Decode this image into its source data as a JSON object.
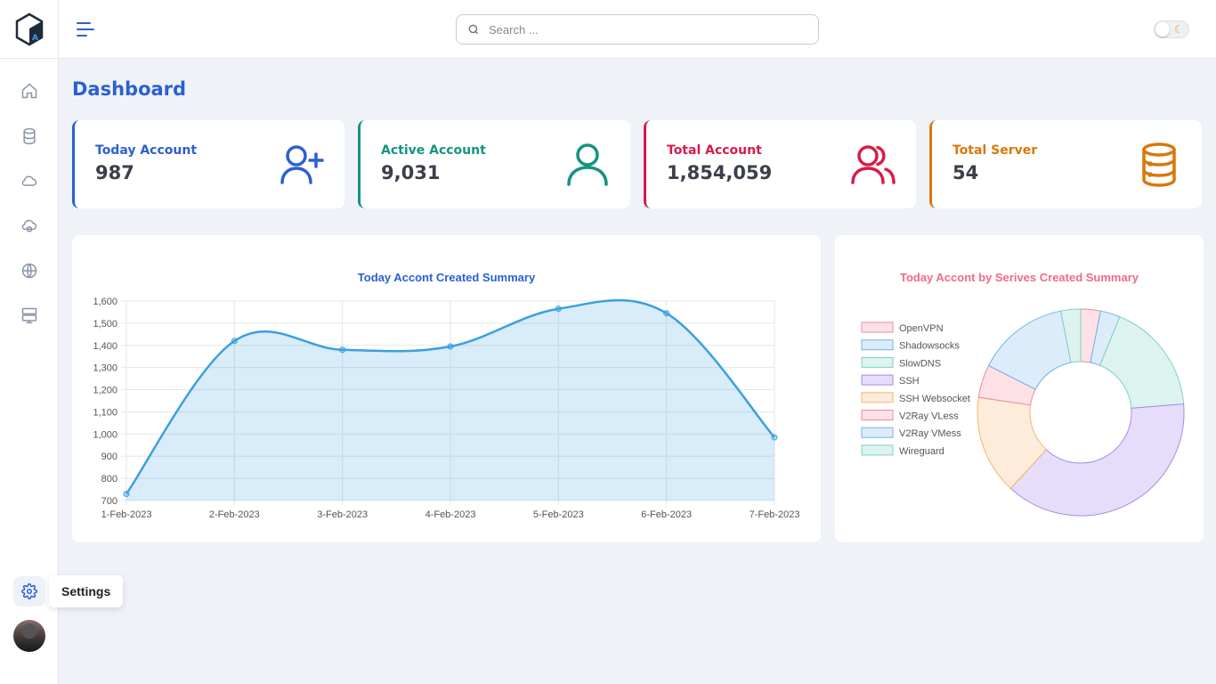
{
  "header": {
    "search_placeholder": "Search ..."
  },
  "sidebar": {
    "items": [
      {
        "icon": "home-icon"
      },
      {
        "icon": "database-icon"
      },
      {
        "icon": "cloud-icon"
      },
      {
        "icon": "cloud-sync-icon"
      },
      {
        "icon": "globe-icon"
      },
      {
        "icon": "server-icon"
      }
    ],
    "settings_tooltip": "Settings"
  },
  "page": {
    "title": "Dashboard"
  },
  "stats": [
    {
      "label": "Today Account",
      "value": "987",
      "color": "#2b5fd4",
      "icon": "user-plus-icon"
    },
    {
      "label": "Active Account",
      "value": "9,031",
      "color": "#15947f",
      "icon": "user-icon"
    },
    {
      "label": "Total Account",
      "value": "1,854,059",
      "color": "#d81b48",
      "icon": "users-icon"
    },
    {
      "label": "Total Server",
      "value": "54",
      "color": "#d9780a",
      "icon": "database-icon"
    }
  ],
  "chart_data": [
    {
      "type": "line",
      "title": "Today Accont Created  Summary",
      "x": [
        "1-Feb-2023",
        "2-Feb-2023",
        "3-Feb-2023",
        "4-Feb-2023",
        "5-Feb-2023",
        "6-Feb-2023",
        "7-Feb-2023"
      ],
      "series": [
        {
          "values": [
            730,
            1420,
            1380,
            1395,
            1565,
            1545,
            985
          ],
          "color": "#3aa0e0",
          "fill": true
        }
      ],
      "ylim": [
        700,
        1600
      ],
      "yticks": [
        "1,600",
        "1,500",
        "1,400",
        "1,300",
        "1,200",
        "1,100",
        "1,000",
        "900",
        "800",
        "700"
      ],
      "grid": true
    },
    {
      "type": "pie",
      "donut": true,
      "title": "Today Accont by Serives Created  Summary",
      "legend_position": "left",
      "categories": [
        "OpenVPN",
        "Shadowsocks",
        "SlowDNS",
        "SSH",
        "SSH Websocket",
        "V2Ray VLess",
        "V2Ray VMess",
        "Wireguard"
      ],
      "values": [
        3,
        3,
        17,
        37,
        15,
        5,
        14,
        3
      ],
      "colors": [
        {
          "fill": "#fde1e7",
          "stroke": "#f08aa0"
        },
        {
          "fill": "#dcecfb",
          "stroke": "#6fb2e8"
        },
        {
          "fill": "#dcf3ef",
          "stroke": "#7fd1c2"
        },
        {
          "fill": "#e6ddfb",
          "stroke": "#a88ae6"
        },
        {
          "fill": "#fdecd9",
          "stroke": "#f4b56e"
        },
        {
          "fill": "#fde1e7",
          "stroke": "#f08aa0"
        },
        {
          "fill": "#dcecfb",
          "stroke": "#6fb2e8"
        },
        {
          "fill": "#dcf3ef",
          "stroke": "#7fd1c2"
        }
      ]
    }
  ]
}
